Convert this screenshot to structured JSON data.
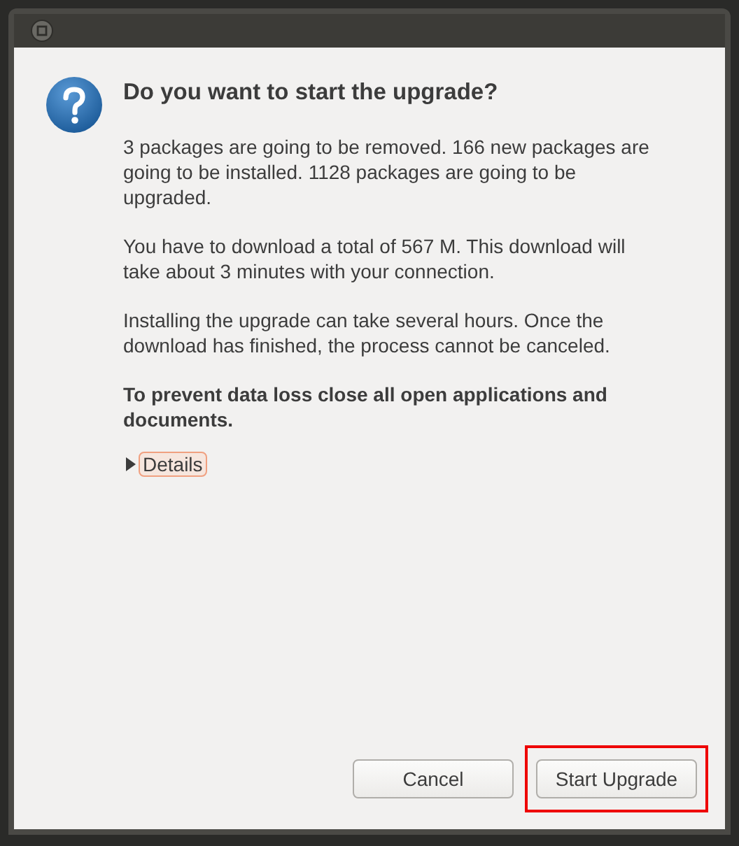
{
  "dialog": {
    "heading": "Do you want to start the upgrade?",
    "paragraphs": [
      "3 packages are going to be removed. 166 new packages are going to be installed. 1128 packages are going to be upgraded.",
      "You have to download a total of 567 M. This download will take about 3 minutes with your connection.",
      "Installing the upgrade can take several hours. Once the download has finished, the process cannot be canceled."
    ],
    "warning": "To prevent data loss close all open applications and documents.",
    "details": {
      "label": "Details",
      "expanded": false
    },
    "buttons": [
      {
        "label": "Cancel",
        "highlighted": false
      },
      {
        "label": "Start Upgrade",
        "highlighted": true
      }
    ]
  }
}
